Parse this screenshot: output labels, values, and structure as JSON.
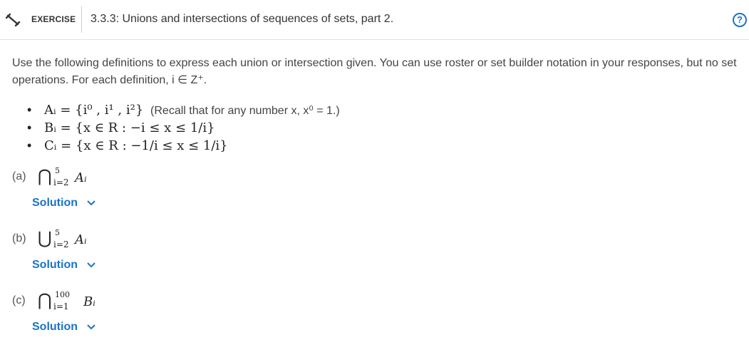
{
  "header": {
    "exercise_label": "EXERCISE",
    "title": "3.3.3: Unions and intersections of sequences of sets, part 2.",
    "help_symbol": "?"
  },
  "intro": "Use the following definitions to express each union or intersection given. You can use roster or set builder notation in your responses, but no set operations. For each definition, i ∈ Z⁺.",
  "definitions": [
    {
      "math": "Aᵢ = {i⁰ , i¹ , i²}",
      "note": "(Recall that for any number x, x⁰ = 1.)"
    },
    {
      "math": "Bᵢ = {x ∈ R : −i ≤ x ≤ 1/i}",
      "note": ""
    },
    {
      "math": "Cᵢ = {x ∈ R : −1/i ≤ x ≤ 1/i}",
      "note": ""
    }
  ],
  "parts": [
    {
      "label": "(a)",
      "operator": "⋂",
      "upper": "5",
      "lower": "i=2",
      "body": "Aᵢ",
      "solution": "Solution"
    },
    {
      "label": "(b)",
      "operator": "⋃",
      "upper": "5",
      "lower": "i=2",
      "body": "Aᵢ",
      "solution": "Solution"
    },
    {
      "label": "(c)",
      "operator": "⋂",
      "upper": "100",
      "lower": "i=1",
      "body": "Bᵢ",
      "solution": "Solution"
    }
  ],
  "colors": {
    "accent": "#1a73c9",
    "text": "#333333",
    "border": "#e2e2e2"
  },
  "icons": {
    "exercise": "dumbbell-icon",
    "help": "help-circle-icon",
    "chevron": "chevron-down-icon"
  }
}
